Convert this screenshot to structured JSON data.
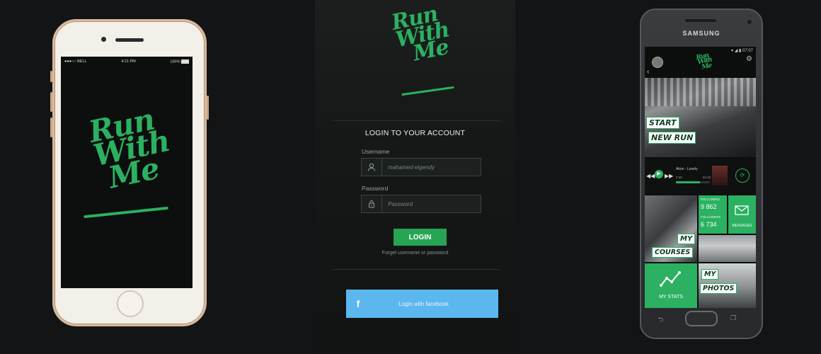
{
  "colors": {
    "brand_green": "#2bb161",
    "facebook_blue": "#5bb7ee",
    "background": "#121416"
  },
  "iphone": {
    "status": {
      "carrier": "●●●○○ BELL",
      "wifi": "wifi-icon",
      "time": "4:21 PM",
      "battery": "100%"
    },
    "logo": [
      "Run",
      "With",
      "Me"
    ]
  },
  "login": {
    "logo": [
      "Run",
      "With",
      "Me"
    ],
    "title": "LOGIN TO YOUR ACCOUNT",
    "username_label": "Username",
    "username_value": "mahamed elgendy",
    "password_label": "Password",
    "password_placeholder": "Password",
    "login_button": "LOGIN",
    "forgot": "Forget username or password",
    "facebook_icon": "f",
    "facebook_button": "Login with facebook"
  },
  "samsung": {
    "brand": "SAMSUNG",
    "status_time": "07:07",
    "logo": [
      "Run",
      "With",
      "Me"
    ],
    "start_run": [
      "START",
      "NEW RUN"
    ],
    "player": {
      "track": "Akon - Lonely",
      "elapsed": "2:30",
      "total": "02:30"
    },
    "following_label": "FOLLOWING",
    "following_value": "9 862",
    "followers_label": "FOLLOWERS",
    "followers_value": "6 734",
    "messages": "MESSAGES",
    "my_courses": [
      "MY",
      "COURSES"
    ],
    "my_stats": "MY STATS",
    "my_photos": [
      "MY",
      "PHOTOS"
    ]
  }
}
